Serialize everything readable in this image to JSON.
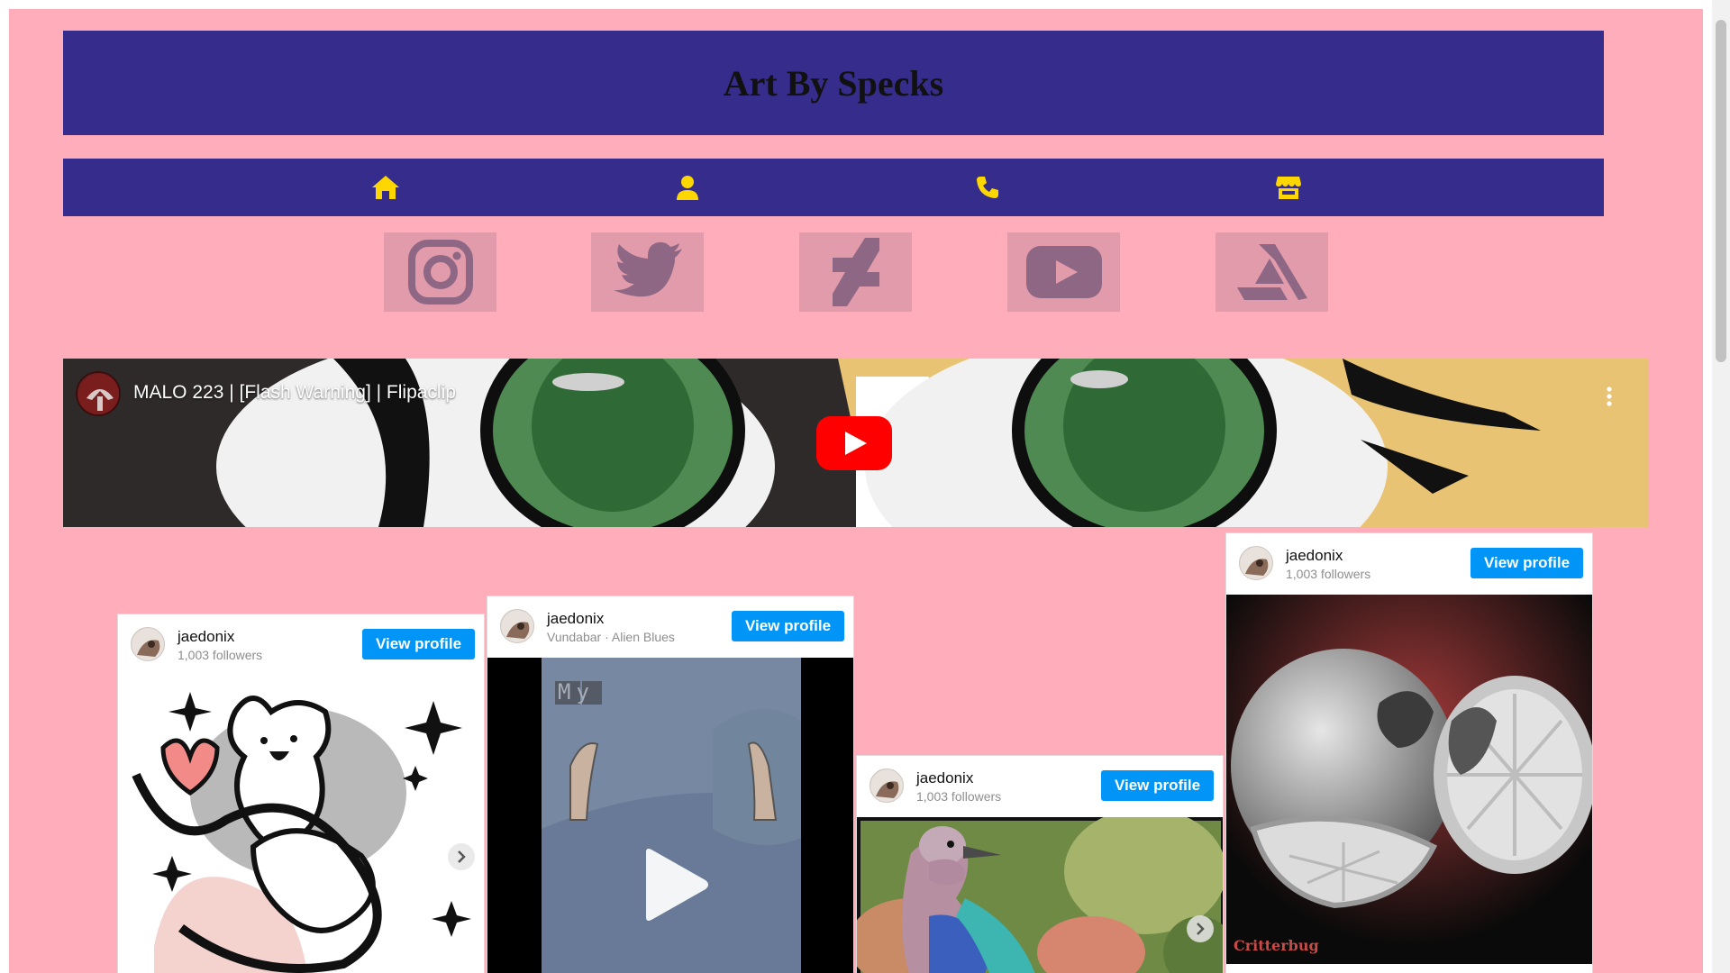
{
  "site": {
    "title": "Art By Specks"
  },
  "nav": {
    "items": [
      {
        "name": "home-icon",
        "label": "Home"
      },
      {
        "name": "user-icon",
        "label": "About"
      },
      {
        "name": "phone-icon",
        "label": "Contact"
      },
      {
        "name": "store-icon",
        "label": "Shop"
      }
    ],
    "icon_color": "#ffd700"
  },
  "social": [
    {
      "name": "instagram-icon"
    },
    {
      "name": "twitter-icon"
    },
    {
      "name": "deviantart-icon"
    },
    {
      "name": "youtube-icon"
    },
    {
      "name": "artstation-icon"
    }
  ],
  "video": {
    "title": "MALO 223 | [Flash Warning] | Flipaclip"
  },
  "instagram_cards": [
    {
      "username": "jaedonix",
      "subtitle": "1,003 followers",
      "button": "View profile"
    },
    {
      "username": "jaedonix",
      "subtitle": "Vundabar · Alien Blues",
      "button": "View profile",
      "overlay_text": "My"
    },
    {
      "username": "jaedonix",
      "subtitle": "1,003 followers",
      "button": "View profile"
    },
    {
      "username": "jaedonix",
      "subtitle": "1,003 followers",
      "button": "View profile",
      "watermark": "Critterbug"
    }
  ],
  "colors": {
    "background": "#ffadbb",
    "header": "#362c8b",
    "button": "#0095f6",
    "social_icon": "#8e6784"
  }
}
